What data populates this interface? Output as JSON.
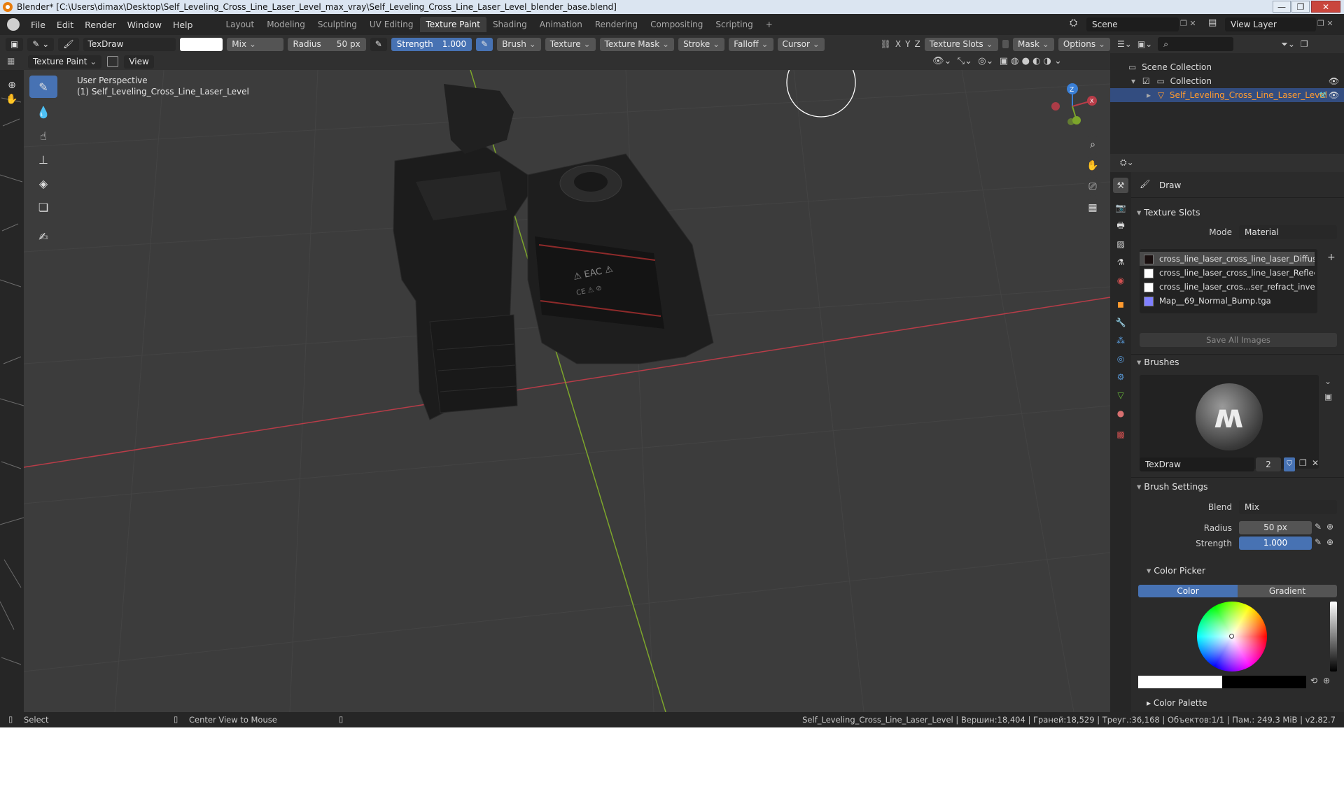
{
  "window": {
    "title": "Blender* [C:\\Users\\dimax\\Desktop\\Self_Leveling_Cross_Line_Laser_Level_max_vray\\Self_Leveling_Cross_Line_Laser_Level_blender_base.blend]",
    "minimize": "—",
    "maximize": "❐",
    "close": "✕"
  },
  "menu": [
    "File",
    "Edit",
    "Render",
    "Window",
    "Help"
  ],
  "workspaces": [
    "Layout",
    "Modeling",
    "Sculpting",
    "UV Editing",
    "Texture Paint",
    "Shading",
    "Animation",
    "Rendering",
    "Compositing",
    "Scripting"
  ],
  "workspace_add": "+",
  "scene": "Scene",
  "view_layer": "View Layer",
  "header": {
    "brush_name": "TexDraw",
    "blend": "Mix",
    "radius_label": "Radius",
    "radius_value": "50 px",
    "strength_label": "Strength",
    "strength_value": "1.000",
    "menus": [
      "Brush",
      "Texture",
      "Texture Mask",
      "Stroke",
      "Falloff",
      "Cursor"
    ],
    "axes": [
      "X",
      "Y",
      "Z"
    ],
    "texture_slots": "Texture Slots",
    "mask": "Mask",
    "options": "Options"
  },
  "header2": {
    "mode": "Texture Paint",
    "view": "View"
  },
  "viewport": {
    "perspective": "User Perspective",
    "object": "(1) Self_Leveling_Cross_Line_Laser_Level",
    "gizmo": {
      "z": "Z",
      "x": "X"
    }
  },
  "outliner": {
    "scene_collection": "Scene Collection",
    "collection": "Collection",
    "object": "Self_Leveling_Cross_Line_Laser_Level"
  },
  "properties": {
    "tool": "Draw",
    "texture_slots": {
      "title": "Texture Slots",
      "mode_label": "Mode",
      "mode_value": "Material",
      "slots": [
        "cross_line_laser_cross_line_laser_Diffuse.p...",
        "cross_line_laser_cross_line_laser_Reflectio...",
        "cross_line_laser_cros...ser_refract_invert.png",
        "Map__69_Normal_Bump.tga"
      ],
      "add": "+",
      "save_all": "Save All Images"
    },
    "brushes": {
      "title": "Brushes",
      "name": "TexDraw",
      "users": "2"
    },
    "brush_settings": {
      "title": "Brush Settings",
      "blend_label": "Blend",
      "blend_value": "Mix",
      "radius_label": "Radius",
      "radius_value": "50 px",
      "strength_label": "Strength",
      "strength_value": "1.000"
    },
    "color_picker": {
      "title": "Color Picker",
      "tab_color": "Color",
      "tab_gradient": "Gradient"
    },
    "color_palette": "Color Palette"
  },
  "status": {
    "left1": "Select",
    "left2": "Center View to Mouse",
    "right": "Self_Leveling_Cross_Line_Laser_Level | Вершин:18,404 | Граней:18,529 | Треуг.:36,168 | Объектов:1/1 | Пам.: 249.3 MiB | v2.82.7"
  },
  "colors": {
    "accent": "#4772b3",
    "selected_object": "#ff9b2f",
    "x_axis": "#b83c48",
    "y_axis": "#7da62b",
    "z_axis": "#3a7fd6"
  }
}
